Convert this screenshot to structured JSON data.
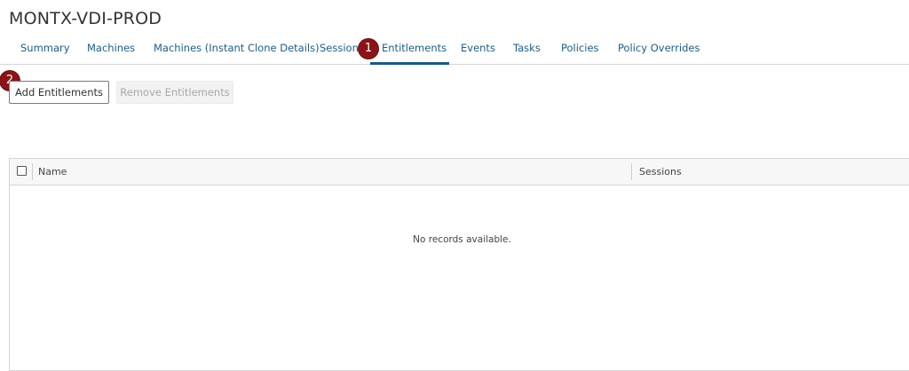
{
  "page": {
    "title": "MONTX-VDI-PROD"
  },
  "tabs": [
    {
      "label": "Summary"
    },
    {
      "label": "Machines"
    },
    {
      "label": "Machines (Instant Clone Details)"
    },
    {
      "label": "Sessions"
    },
    {
      "label": "Entitlements",
      "active": true
    },
    {
      "label": "Events"
    },
    {
      "label": "Tasks"
    },
    {
      "label": "Policies"
    },
    {
      "label": "Policy Overrides"
    }
  ],
  "callouts": {
    "one": "1",
    "two": "2"
  },
  "toolbar": {
    "add_label": "Add Entitlements",
    "remove_label": "Remove Entitlements"
  },
  "table": {
    "columns": [
      {
        "label": "Name"
      },
      {
        "label": "Sessions"
      }
    ],
    "empty_message": "No records available."
  },
  "colors": {
    "accent": "#1d5c87",
    "callout": "#8b1418",
    "disabled_text": "#a8a8a8"
  }
}
